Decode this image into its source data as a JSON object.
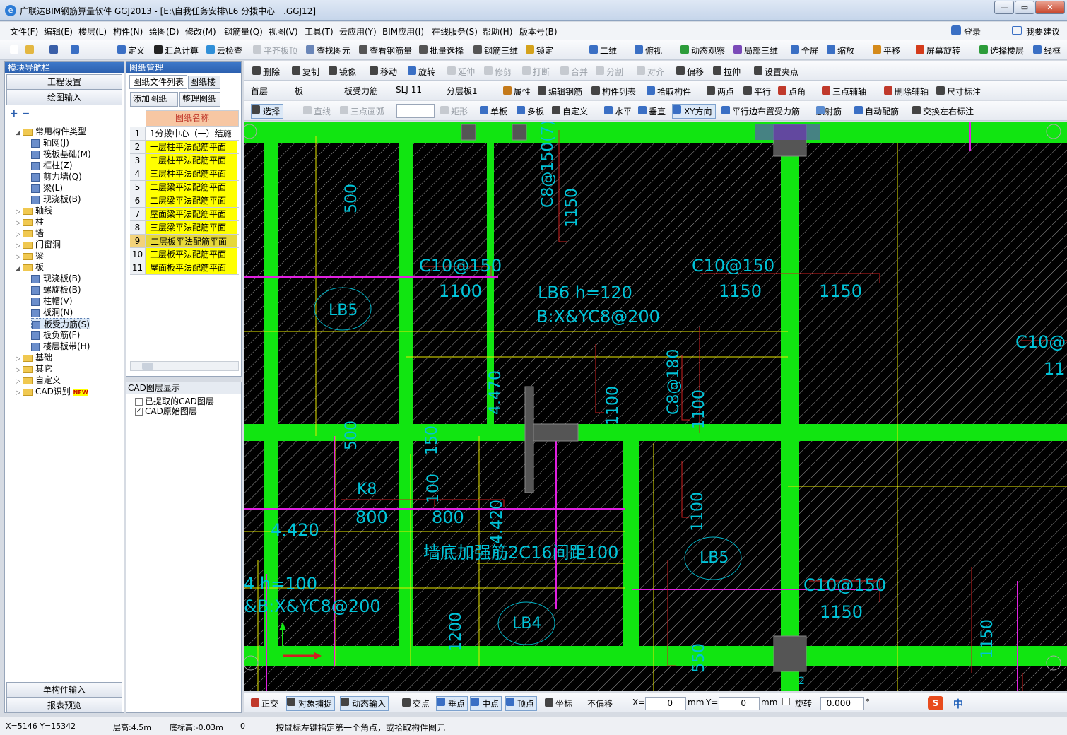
{
  "window": {
    "title": "广联达BIM钢筋算量软件 GGJ2013 - [E:\\自我任务安排\\L6 分拨中心一.GGJ12]"
  },
  "menu": [
    "文件(F)",
    "编辑(E)",
    "楼层(L)",
    "构件(N)",
    "绘图(D)",
    "修改(M)",
    "钢筋量(Q)",
    "视图(V)",
    "工具(T)",
    "云应用(Y)",
    "BIM应用(I)",
    "在线服务(S)",
    "帮助(H)",
    "版本号(B)"
  ],
  "menu_right": {
    "login": "登录",
    "suggest": "我要建议"
  },
  "toolbar1": [
    "定义",
    "汇总计算",
    "云检查",
    "平齐板顶",
    "查找图元",
    "查看钢筋量",
    "批量选择",
    "钢筋三维",
    "锁定"
  ],
  "toolbar1_right": [
    "二维",
    "俯视",
    "动态观察",
    "局部三维",
    "全屏",
    "缩放",
    "平移",
    "屏幕旋转",
    "选择楼层",
    "线框"
  ],
  "toolbar2": [
    "删除",
    "复制",
    "镜像",
    "移动",
    "旋转",
    "延伸",
    "修剪",
    "打断",
    "合并",
    "分割",
    "对齐",
    "偏移",
    "拉伸",
    "设置夹点"
  ],
  "toolbar3": {
    "floor": "首层",
    "type": "板",
    "subtype": "板受力筋",
    "name": "SLJ-11",
    "layer": "分层板1",
    "items": [
      "属性",
      "编辑钢筋",
      "构件列表",
      "拾取构件",
      "两点",
      "平行",
      "点角",
      "三点辅轴",
      "删除辅轴",
      "尺寸标注"
    ]
  },
  "toolbar4": [
    "选择",
    "直线",
    "三点画弧",
    "矩形",
    "单板",
    "多板",
    "自定义",
    "水平",
    "垂直",
    "XY方向",
    "平行边布置受力筋",
    "放射筋",
    "自动配筋",
    "交换左右标注"
  ],
  "nav": {
    "header": "模块导航栏",
    "top_buttons": [
      "工程设置",
      "绘图输入"
    ],
    "bottom_buttons": [
      "单构件输入",
      "报表预览"
    ],
    "tree": [
      {
        "label": "常用构件类型",
        "level": 0,
        "folder": true,
        "open": true
      },
      {
        "label": "轴网(J)",
        "level": 1
      },
      {
        "label": "筏板基础(M)",
        "level": 1
      },
      {
        "label": "框柱(Z)",
        "level": 1
      },
      {
        "label": "剪力墙(Q)",
        "level": 1
      },
      {
        "label": "梁(L)",
        "level": 1
      },
      {
        "label": "现浇板(B)",
        "level": 1
      },
      {
        "label": "轴线",
        "level": 0,
        "folder": true
      },
      {
        "label": "柱",
        "level": 0,
        "folder": true
      },
      {
        "label": "墙",
        "level": 0,
        "folder": true
      },
      {
        "label": "门窗洞",
        "level": 0,
        "folder": true
      },
      {
        "label": "梁",
        "level": 0,
        "folder": true
      },
      {
        "label": "板",
        "level": 0,
        "folder": true,
        "open": true
      },
      {
        "label": "现浇板(B)",
        "level": 1
      },
      {
        "label": "螺旋板(B)",
        "level": 1
      },
      {
        "label": "柱帽(V)",
        "level": 1
      },
      {
        "label": "板洞(N)",
        "level": 1
      },
      {
        "label": "板受力筋(S)",
        "level": 1,
        "selected": true
      },
      {
        "label": "板负筋(F)",
        "level": 1
      },
      {
        "label": "楼层板带(H)",
        "level": 1
      },
      {
        "label": "基础",
        "level": 0,
        "folder": true
      },
      {
        "label": "其它",
        "level": 0,
        "folder": true
      },
      {
        "label": "自定义",
        "level": 0,
        "folder": true
      },
      {
        "label": "CAD识别",
        "level": 0,
        "folder": true,
        "badge": "NEW"
      }
    ]
  },
  "drawings": {
    "header": "图纸管理",
    "tabs": [
      "图纸文件列表",
      "图纸楼"
    ],
    "buttons": [
      "添加图纸",
      "整理图纸"
    ],
    "column": "图纸名称",
    "rows": [
      {
        "no": "1",
        "name": "1分拨中心（一）结施"
      },
      {
        "no": "2",
        "name": "一层柱平法配筋平面"
      },
      {
        "no": "3",
        "name": "二层柱平法配筋平面"
      },
      {
        "no": "4",
        "name": "三层柱平法配筋平面"
      },
      {
        "no": "5",
        "name": "二层梁平法配筋平面"
      },
      {
        "no": "6",
        "name": "二层梁平法配筋平面"
      },
      {
        "no": "7",
        "name": "屋面梁平法配筋平面"
      },
      {
        "no": "8",
        "name": "三层梁平法配筋平面"
      },
      {
        "no": "9",
        "name": "二层板平法配筋平面"
      },
      {
        "no": "10",
        "name": "三层板平法配筋平面"
      },
      {
        "no": "11",
        "name": "屋面板平法配筋平面"
      }
    ]
  },
  "cad_layers": {
    "header": "CAD图层显示",
    "items": [
      "已提取的CAD图层",
      "CAD原始图层"
    ]
  },
  "canvas_labels": [
    {
      "t": "500"
    },
    {
      "t": "C8@150(7)"
    },
    {
      "t": "1150"
    },
    {
      "t": "C10@150"
    },
    {
      "t": "1100"
    },
    {
      "t": "LB5"
    },
    {
      "t": "LB6 h=120"
    },
    {
      "t": "B:X&YC8@200"
    },
    {
      "t": "C10@150"
    },
    {
      "t": "1150"
    },
    {
      "t": "1150"
    },
    {
      "t": "C10@"
    },
    {
      "t": "11"
    },
    {
      "t": "4.470"
    },
    {
      "t": "1100"
    },
    {
      "t": "C8@180"
    },
    {
      "t": "1100"
    },
    {
      "t": "500"
    },
    {
      "t": "150"
    },
    {
      "t": "100"
    },
    {
      "t": "K8"
    },
    {
      "t": "800"
    },
    {
      "t": "800"
    },
    {
      "t": "4.420"
    },
    {
      "t": "4.420"
    },
    {
      "t": "1100"
    },
    {
      "t": "墙底加强筋2C16间距100"
    },
    {
      "t": "LB5"
    },
    {
      "t": "C10@150"
    },
    {
      "t": "1150"
    },
    {
      "t": "4 h=100"
    },
    {
      "t": "&B:X&YC8@200"
    },
    {
      "t": "1200"
    },
    {
      "t": "LB4"
    },
    {
      "t": "550"
    },
    {
      "t": "1150"
    },
    {
      "t": "50"
    },
    {
      "t": "0"
    },
    {
      "t": "2"
    }
  ],
  "snapbar": {
    "items": [
      "正交",
      "对象捕捉",
      "动态输入",
      "交点",
      "垂点",
      "中点",
      "顶点",
      "坐标"
    ],
    "offset": "不偏移",
    "x_label": "X=",
    "x_value": "0",
    "y_label": "Y=",
    "y_value": "0",
    "unit": "mm",
    "rotate_label": "旋转",
    "rotate_value": "0.000",
    "deg": "°"
  },
  "status": {
    "coords": "X=5146 Y=15342",
    "floor_height": "层高:4.5m",
    "base_height": "底标高:-0.03m",
    "zero": "0",
    "hint": "按鼠标左键指定第一个角点，或拾取构件图元"
  },
  "ime": {
    "lang": "中"
  }
}
